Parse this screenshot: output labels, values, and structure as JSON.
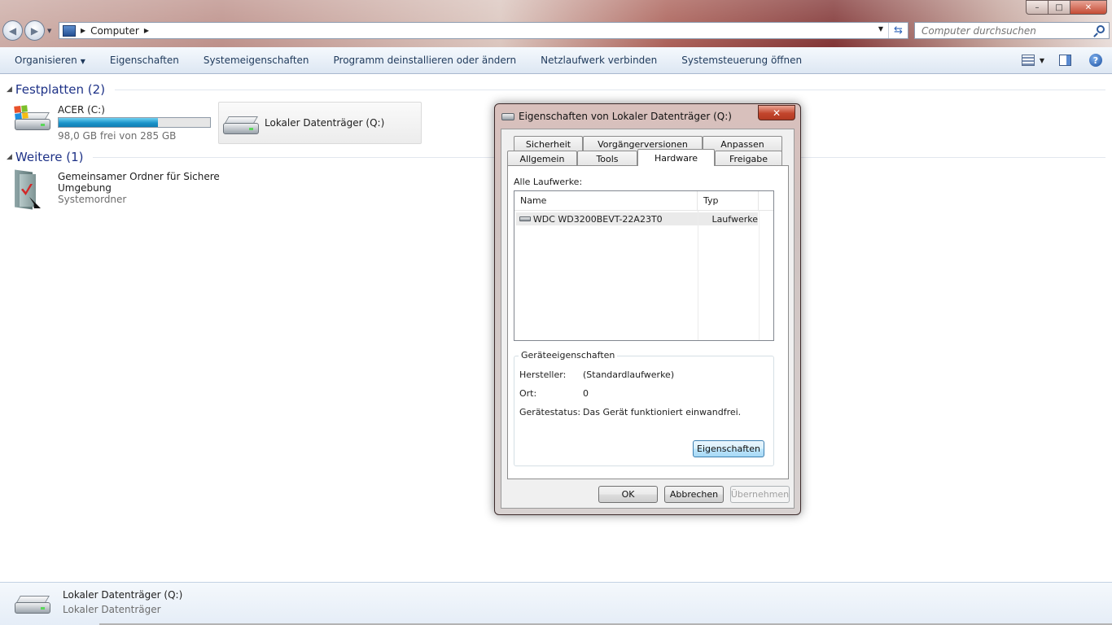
{
  "window": {
    "minimize": "–",
    "maximize": "□",
    "close": "✕"
  },
  "address": {
    "crumb": "Computer",
    "search_placeholder": "Computer durchsuchen"
  },
  "toolbar": {
    "items": [
      "Organisieren",
      "Eigenschaften",
      "Systemeigenschaften",
      "Programm deinstallieren oder ändern",
      "Netzlaufwerk verbinden",
      "Systemsteuerung öffnen"
    ],
    "help": "?"
  },
  "groups": {
    "drives_title": "Festplatten (2)",
    "other_title": "Weitere (1)"
  },
  "drives": {
    "c_name": "ACER (C:)",
    "c_free": "98,0 GB frei von 285 GB",
    "c_used_fraction": 0.656,
    "q_name": "Lokaler Datenträger (Q:)"
  },
  "other": {
    "name_line1": "Gemeinsamer Ordner für Sichere",
    "name_line2": "Umgebung",
    "type": "Systemordner"
  },
  "details": {
    "name": "Lokaler Datenträger (Q:)",
    "type": "Lokaler Datenträger"
  },
  "dialog": {
    "title": "Eigenschaften von Lokaler Datenträger (Q:)",
    "close": "✕",
    "tabs_back": [
      "Sicherheit",
      "Vorgängerversionen",
      "Anpassen"
    ],
    "tabs_front": [
      "Allgemein",
      "Tools",
      "Hardware",
      "Freigabe"
    ],
    "all_drives_label": "Alle Laufwerke:",
    "columns": [
      "Name",
      "Typ"
    ],
    "rows": [
      {
        "name": "WDC WD3200BEVT-22A23T0",
        "type": "Laufwerke"
      }
    ],
    "group_title": "Geräteeigenschaften",
    "props": [
      {
        "label": "Hersteller:",
        "value": "(Standardlaufwerke)"
      },
      {
        "label": "Ort:",
        "value": "0"
      },
      {
        "label": "Gerätestatus:",
        "value": "Das Gerät funktioniert einwandfrei."
      }
    ],
    "properties_button": "Eigenschaften",
    "ok": "OK",
    "cancel": "Abbrechen",
    "apply": "Übernehmen"
  }
}
